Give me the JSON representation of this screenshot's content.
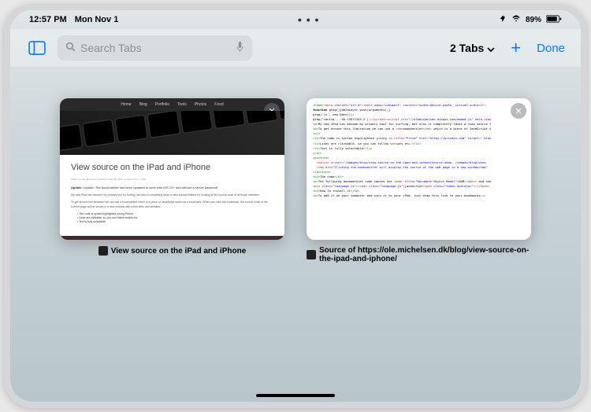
{
  "statusBar": {
    "time": "12:57 PM",
    "date": "Mon Nov 1",
    "ellipsis": "• • •",
    "battery": "89%"
  },
  "toolbar": {
    "searchPlaceholder": "Search Tabs",
    "tabCount": "2 Tabs",
    "done": "Done"
  },
  "tabs": [
    {
      "title": "View source on the iPad and iPhone",
      "nav": [
        "Home",
        "Blog",
        "Portfolio",
        "Tools",
        "Photos",
        "Food"
      ],
      "heading": "View source on the iPad and iPhone",
      "byline": "Written by Ole Michelsen posted on Feb 28, 2012, updated Nov 1, 2021",
      "update": "Update: The bookmarklet has been updated to work with iOS 13+ and without a server backend!",
      "para1": "My new iPad has become my primary tool for surfing, but also it completely lacks a view source feature for looking at the source code of all those websites.",
      "para2": "To get around this limitation we can use a bookmarklet which is a piece of JavaScript saved as a bookmark. When you click the bookmark, the source code of the current page will be shown in a new window with a few bells and whistles.",
      "bullets": [
        "The code is syntax highlighted (using Prism)",
        "Links are clickable, so you can follow scripts etc.",
        "Text is fully selectable"
      ]
    },
    {
      "title": "Source of https://ole.michelsen.dk/blog/view-source-on-the-ipad-and-iphone/"
    }
  ]
}
